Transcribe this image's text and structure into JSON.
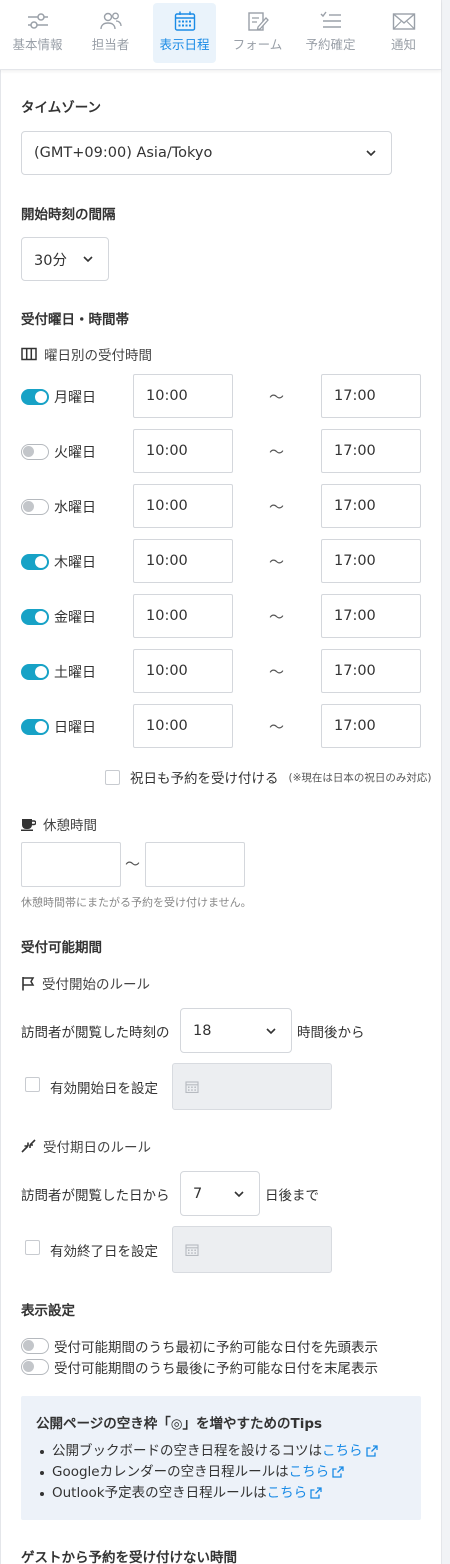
{
  "tabs": [
    {
      "label": "基本情報",
      "icon": "sliders-icon",
      "active": false
    },
    {
      "label": "担当者",
      "icon": "users-icon",
      "active": false
    },
    {
      "label": "表示日程",
      "icon": "calendar-icon",
      "active": true
    },
    {
      "label": "フォーム",
      "icon": "form-edit-icon",
      "active": false
    },
    {
      "label": "予約確定",
      "icon": "checklist-icon",
      "active": false
    },
    {
      "label": "通知",
      "icon": "mail-icon",
      "active": false
    }
  ],
  "timezone": {
    "title": "タイムゾーン",
    "value": "(GMT+09:00) Asia/Tokyo"
  },
  "interval": {
    "title": "開始時刻の間隔",
    "value": "30分"
  },
  "reception": {
    "title": "受付曜日・時間帯",
    "weekly_title": "曜日別の受付時間",
    "separator": "〜",
    "days": [
      {
        "label": "月曜日",
        "enabled": true,
        "start": "10:00",
        "end": "17:00"
      },
      {
        "label": "火曜日",
        "enabled": false,
        "start": "10:00",
        "end": "17:00"
      },
      {
        "label": "水曜日",
        "enabled": false,
        "start": "10:00",
        "end": "17:00"
      },
      {
        "label": "木曜日",
        "enabled": true,
        "start": "10:00",
        "end": "17:00"
      },
      {
        "label": "金曜日",
        "enabled": true,
        "start": "10:00",
        "end": "17:00"
      },
      {
        "label": "土曜日",
        "enabled": true,
        "start": "10:00",
        "end": "17:00"
      },
      {
        "label": "日曜日",
        "enabled": true,
        "start": "10:00",
        "end": "17:00"
      }
    ],
    "holiday_label": "祝日も予約を受け付ける",
    "holiday_note": "(※現在は日本の祝日のみ対応)",
    "holiday_checked": false
  },
  "break_time": {
    "title": "休憩時間",
    "start": "",
    "end": "",
    "separator": "〜",
    "hint": "休憩時間帯にまたがる予約を受け付けません。"
  },
  "period": {
    "title": "受付可能期間",
    "start_rule_title": "受付開始のルール",
    "start_prefix": "訪問者が閲覧した時刻の",
    "start_value": "18",
    "start_suffix": "時間後から",
    "start_date_label": "有効開始日を設定",
    "end_rule_title": "受付期日のルール",
    "end_prefix": "訪問者が閲覧した日から",
    "end_value": "7",
    "end_suffix": "日後まで",
    "end_date_label": "有効終了日を設定"
  },
  "display": {
    "title": "表示設定",
    "options": [
      {
        "label": "受付可能期間のうち最初に予約可能な日付を先頭表示",
        "enabled": false
      },
      {
        "label": "受付可能期間のうち最後に予約可能な日付を末尾表示",
        "enabled": false
      }
    ]
  },
  "tips": {
    "title": "公開ページの空き枠「◎」を増やすためのTips",
    "items": [
      {
        "text": "公開ブックボードの空き日程を設けるコツは",
        "link": "こちら"
      },
      {
        "text": "Googleカレンダーの空き日程ルールは",
        "link": "こちら"
      },
      {
        "text": "Outlook予定表の空き日程ルールは",
        "link": "こちら"
      }
    ]
  },
  "guest_block": {
    "title": "ゲストから予約を受け付けない時間"
  },
  "colors": {
    "accent": "#1a8be6",
    "toggle_on": "#17a2c6",
    "tips_bg": "#edf2f9"
  }
}
